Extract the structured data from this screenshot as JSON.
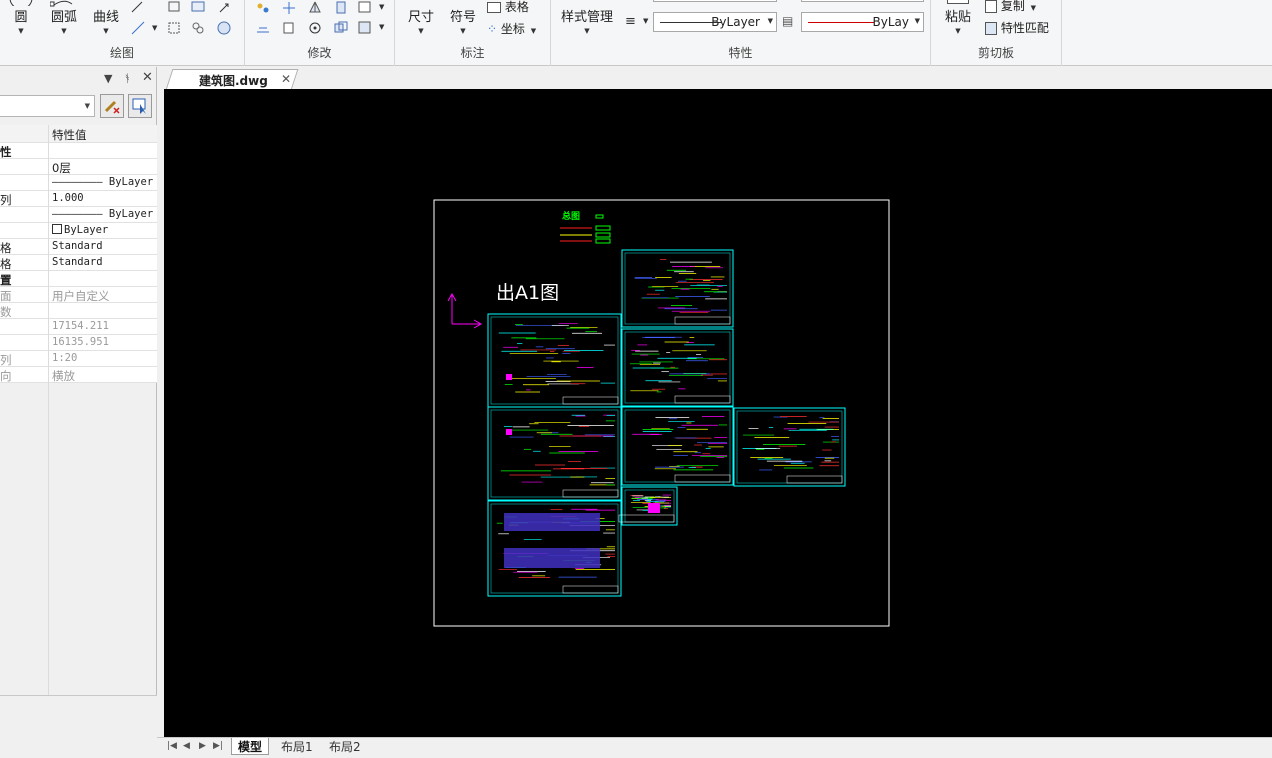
{
  "ribbon": {
    "draw": {
      "title": "绘图",
      "circle": "圆",
      "arc": "圆弧",
      "curve": "曲线"
    },
    "modify": {
      "title": "修改"
    },
    "annotate": {
      "title": "标注",
      "dimension": "尺寸",
      "symbol": "符号",
      "table": "表格",
      "coord": "坐标"
    },
    "properties": {
      "title": "特性",
      "style_manager": "样式管理",
      "linetype_value": "ByLayer",
      "color_value": "ByLay",
      "color_swatch": "#cc0000"
    },
    "clipboard": {
      "title": "剪切板",
      "paste": "粘贴",
      "copy": "复制",
      "match_prop": "特性匹配"
    }
  },
  "panel": {
    "header": {
      "col_prop": "",
      "col_value": "特性值"
    },
    "rows": [
      {
        "key": "性",
        "value": "",
        "type": "cat"
      },
      {
        "key": "",
        "value": "0层",
        "type": "row"
      },
      {
        "key": "",
        "value": "———————— ByLayer",
        "type": "row"
      },
      {
        "key": "列",
        "value": "1.000",
        "type": "row"
      },
      {
        "key": "",
        "value": "———————— ByLayer",
        "type": "row"
      },
      {
        "key": "",
        "value": "ByLayer",
        "type": "swatch"
      },
      {
        "key": "格",
        "value": "Standard",
        "type": "row"
      },
      {
        "key": "格",
        "value": "Standard",
        "type": "row"
      },
      {
        "key": "置",
        "value": "",
        "type": "cat"
      },
      {
        "key": "面",
        "value": "用户自定义",
        "type": "dim"
      },
      {
        "key": "数",
        "value": "",
        "type": "dim"
      },
      {
        "key": "",
        "value": "17154.211",
        "type": "dim"
      },
      {
        "key": "",
        "value": "16135.951",
        "type": "dim"
      },
      {
        "key": "列",
        "value": "1:20",
        "type": "dim"
      },
      {
        "key": "向",
        "value": "横放",
        "type": "dim"
      }
    ]
  },
  "document": {
    "tab_label": "建筑图.dwg",
    "canvas_bg": "#000000"
  },
  "drawing": {
    "title_text": "出A1图",
    "legend_title": "总图"
  },
  "layout_tabs": [
    "模型",
    "布局1",
    "布局2"
  ],
  "active_layout": "模型"
}
